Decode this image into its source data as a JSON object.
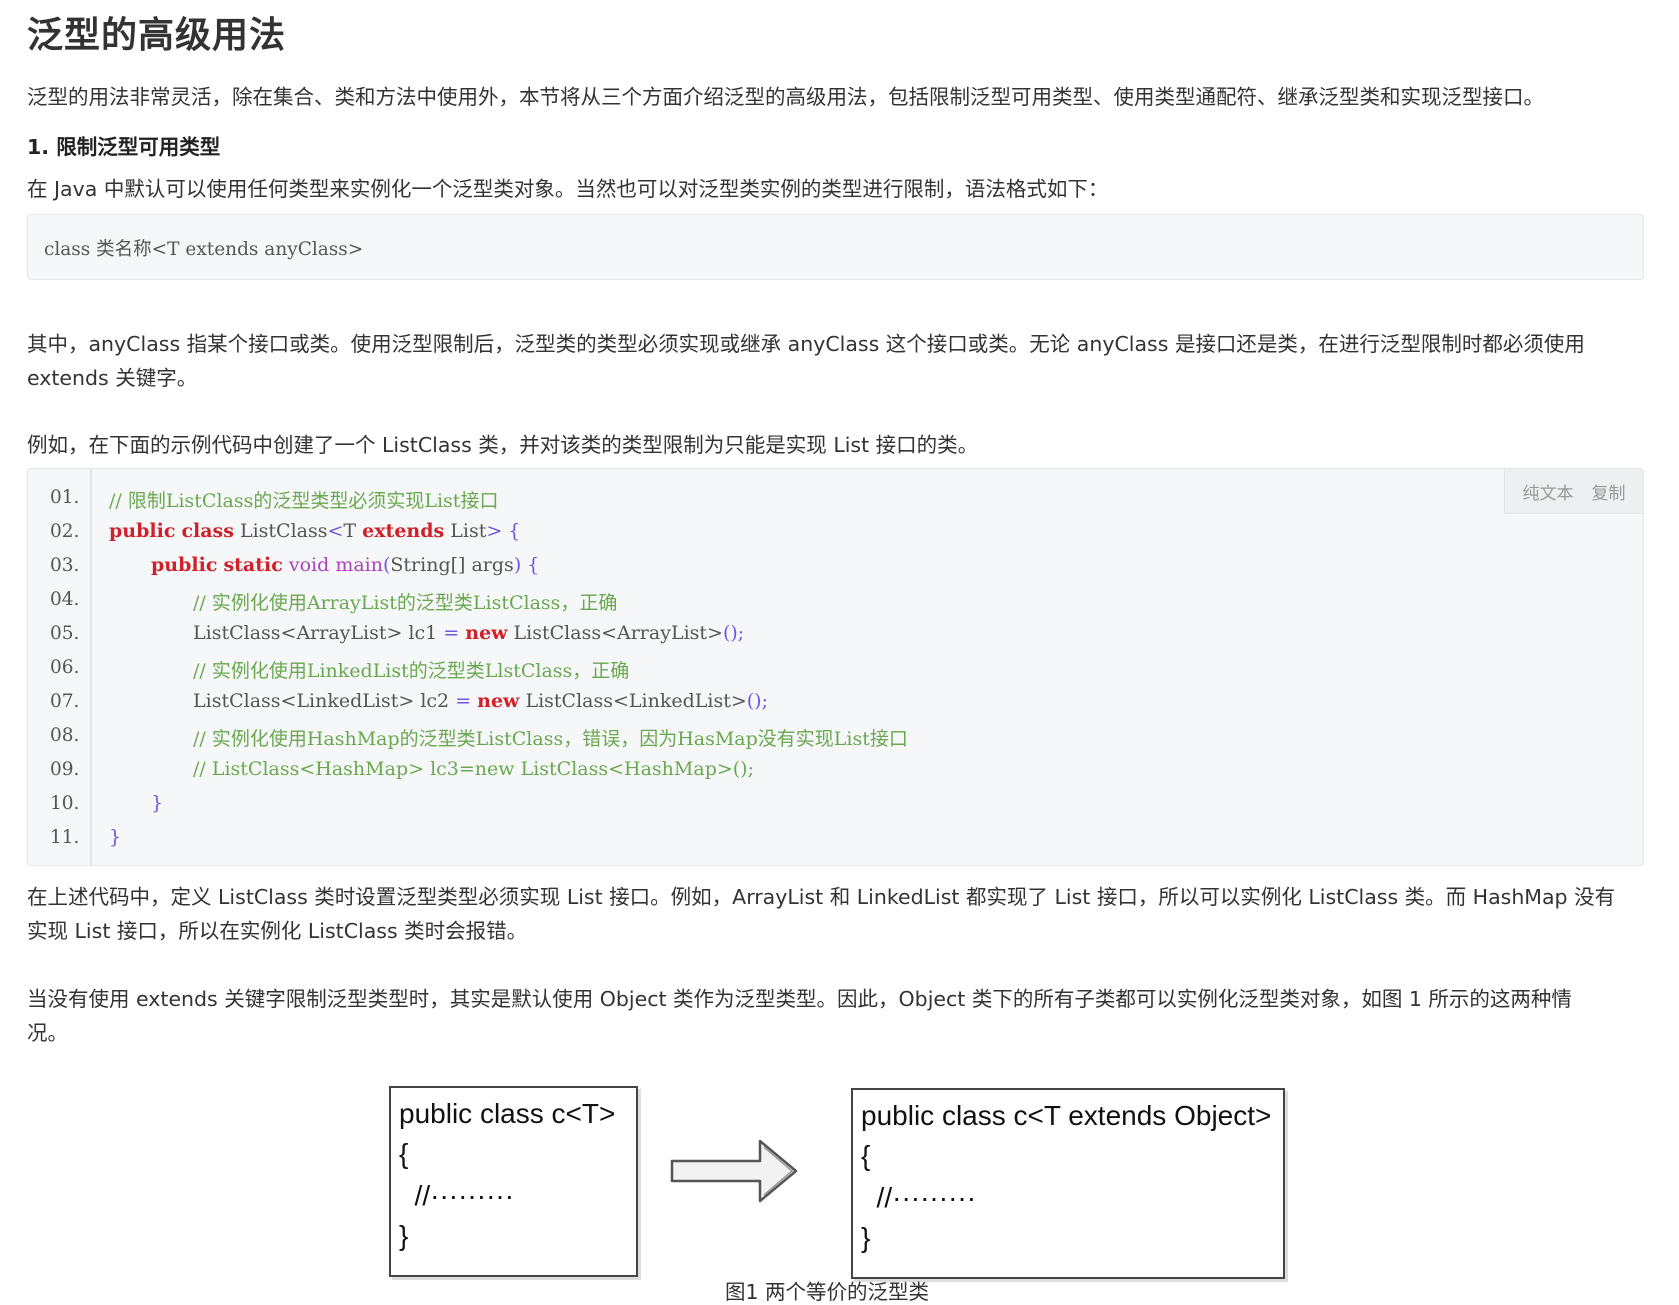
{
  "title": "泛型的高级用法",
  "intro": "泛型的用法非常灵活，除在集合、类和方法中使用外，本节将从三个方面介绍泛型的高级用法，包括限制泛型可用类型、使用类型通配符、继承泛型类和实现泛型接口。",
  "section1_heading": "1. 限制泛型可用类型",
  "section1_p1": "在 Java 中默认可以使用任何类型来实例化一个泛型类对象。当然也可以对泛型类实例的类型进行限制，语法格式如下：",
  "syntax": "class 类名称<T extends anyClass>",
  "p2_line1": "其中，anyClass 指某个接口或类。使用泛型限制后，泛型类的类型必须实现或继承 anyClass 这个接口或类。无论 anyClass 是接口还是类，在进行泛型限制时都必须使用",
  "p2_line2": "extends 关键字。",
  "p3": "例如，在下面的示例代码中创建了一个 ListClass 类，并对该类的类型限制为只能是实现 List 接口的类。",
  "code_toolbar": {
    "plain": "纯文本",
    "copy": "复制"
  },
  "code": {
    "line_numbers": [
      "01.",
      "02.",
      "03.",
      "04.",
      "05.",
      "06.",
      "07.",
      "08.",
      "09.",
      "10.",
      "11."
    ],
    "l1": "// 限制ListClass的泛型类型必须实现List接口",
    "l2_kw1": "public",
    "l2_kw2": "class",
    "l2_rest1": " ListClass",
    "l2_lt": "<",
    "l2_t": "T ",
    "l2_kw3": "extends",
    "l2_rest2": " List",
    "l2_gt": ">",
    "l2_brace": " {",
    "l3_kw1": "public",
    "l3_kw2": "static",
    "l3_void": "void",
    "l3_main": "main",
    "l3_paren_open": "(",
    "l3_args": "String[] args",
    "l3_paren_close": ")",
    "l3_brace": " {",
    "l4": "// 实例化使用ArrayList的泛型类ListClass，正确",
    "l5_a": "ListClass<ArrayList> lc1 ",
    "l5_eq": "=",
    "l5_new": "new",
    "l5_b": " ListClass<ArrayList>",
    "l5_c": "();",
    "l6": "// 实例化使用LinkedList的泛型类LlstClass，正确",
    "l7_a": "ListClass<LinkedList> lc2 ",
    "l7_eq": "=",
    "l7_new": "new",
    "l7_b": " ListClass<LinkedList>",
    "l7_c": "();",
    "l8": "// 实例化使用HashMap的泛型类ListClass，错误，因为HasMap没有实现List接口",
    "l9": "// ListClass<HashMap> lc3=new ListClass<HashMap>();",
    "l10": "}",
    "l11": "}"
  },
  "p4_line1": "在上述代码中，定义 ListClass 类时设置泛型类型必须实现 List 接口。例如，ArrayList 和 LinkedList 都实现了 List 接口，所以可以实例化 ListClass 类。而 HashMap 没有",
  "p4_line2": "实现 List 接口，所以在实例化 ListClass 类时会报错。",
  "p5_line1": "当没有使用 extends 关键字限制泛型类型时，其实是默认使用 Object 类作为泛型类型。因此，Object 类下的所有子类都可以实例化泛型类对象，如图 1 所示的这两种情",
  "p5_line2": "况。",
  "figure": {
    "left_box": [
      "public class c<T>",
      "{",
      "  //·········",
      "}"
    ],
    "right_box": [
      "public class c<T extends Object>",
      "{",
      "  //·········",
      "}"
    ],
    "caption": "图1  两个等价的泛型类"
  }
}
